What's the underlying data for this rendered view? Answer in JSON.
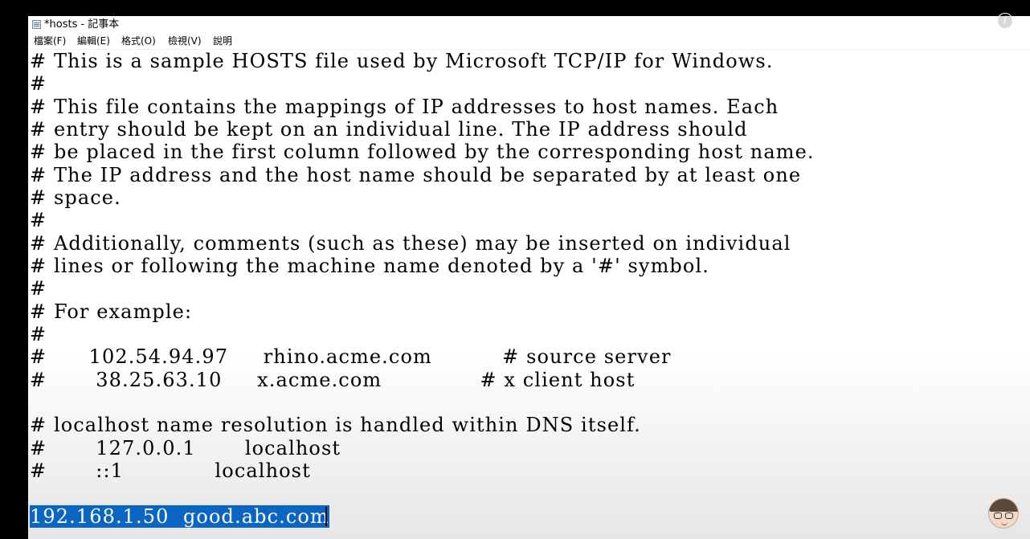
{
  "window": {
    "title": "*hosts - 記事本"
  },
  "menu": {
    "file": "檔案(F)",
    "edit": "編輯(E)",
    "format": "格式(O)",
    "view": "檢視(V)",
    "help": "說明"
  },
  "editor": {
    "lines": [
      "# This is a sample HOSTS file used by Microsoft TCP/IP for Windows.",
      "#",
      "# This file contains the mappings of IP addresses to host names. Each",
      "# entry should be kept on an individual line. The IP address should",
      "# be placed in the first column followed by the corresponding host name.",
      "# The IP address and the host name should be separated by at least one",
      "# space.",
      "#",
      "# Additionally, comments (such as these) may be inserted on individual",
      "# lines or following the machine name denoted by a '#' symbol.",
      "#",
      "# For example:",
      "#",
      "#      102.54.94.97     rhino.acme.com          # source server",
      "#       38.25.63.10     x.acme.com              # x client host",
      "",
      "# localhost name resolution is handled within DNS itself.",
      "#       127.0.0.1       localhost",
      "#       ::1             localhost",
      "",
      "192.168.1.50  good.abc.com"
    ]
  },
  "overlay": {
    "info_icon_label": "i"
  },
  "colors": {
    "selection": "#0a66c2",
    "background": "#000000"
  }
}
